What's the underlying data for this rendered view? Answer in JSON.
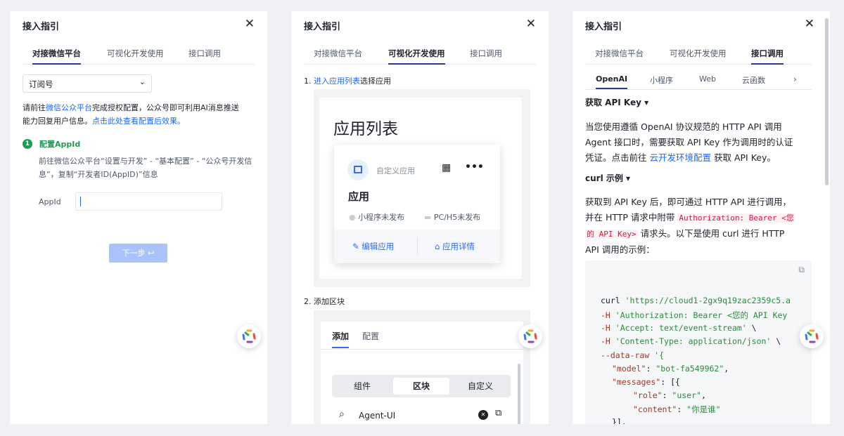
{
  "panel_title": "接入指引",
  "tabs": [
    "对接微信平台",
    "可视化开发使用",
    "接口调用"
  ],
  "p1": {
    "select_value": "订阅号",
    "desc_pre": "请前往",
    "desc_link": "微信公众平台",
    "desc_post": "完成授权配置，公众号即可利用AI消息推送",
    "desc_line2_pre": "能力回复用户信息。",
    "desc_line2_link": "点击此处查看配置后效果。",
    "step_num": "1",
    "step_title": "配置AppId",
    "step_desc_1": "前往微信公众平台“设置与开发” - “基本配置” - “公众号开发信",
    "step_desc_2": "息”，复制“开发者ID(AppID)”信息",
    "appid_label": "AppId",
    "next_label": "下一步 ↩"
  },
  "p2": {
    "step1_num": "1. ",
    "step1_link": "进入应用列表",
    "step1_post": "选择应用",
    "app_list_title": "应用列表",
    "custom_app": "自定义应用",
    "app_name": "应用",
    "status_mp": "小程序未发布",
    "status_pc": "PC/H5未发布",
    "edit_app": "编辑应用",
    "app_detail": "应用详情",
    "step2": "2. 添加区块",
    "add_tab": "添加",
    "config_tab": "配置",
    "seg": [
      "组件",
      "区块",
      "自定义"
    ],
    "search_value": "Agent-UI"
  },
  "p3": {
    "subtabs": [
      "OpenAI",
      "小程序",
      "Web",
      "云函数"
    ],
    "sec_api": "获取 API Key ▾",
    "api_l1": "当您使用遵循 OpenAI 协议规范的 HTTP API 调用",
    "api_l2": "Agent 接口时，需要获取 API Key 作为调用时的认证",
    "api_l3_pre": "凭证。点击前往 ",
    "api_l3_link": "云开发环境配置",
    "api_l3_post": " 获取 API Key。",
    "sec_curl": "curl 示例 ▾",
    "curl_l1": "获取到 API Key 后，即可通过 HTTP API 进行调用，",
    "curl_l2_pre": "并在 HTTP 请求中附带 ",
    "curl_l2_code": "Authorization: Bearer <您",
    "curl_l3_code": "的 API Key>",
    "curl_l3_post": " 请求头。以下是使用 curl 进行 HTTP",
    "curl_l4": "API 调用的示例：",
    "code": {
      "l1a": "curl ",
      "l1b": "'https://cloud1-2gx9q19zac2359c5.a",
      "l2a": "-H ",
      "l2b": "'Authorization: Bearer <您的 API Key",
      "l3a": "-H ",
      "l3b": "'Accept: text/event-stream'",
      "l3c": " \\",
      "l4a": "-H ",
      "l4b": "'Content-Type: application/json'",
      "l4c": " \\",
      "l5a": "--data-raw ",
      "l5b": "'{",
      "l6a": "\"model\"",
      "l6b": ": ",
      "l6c": "\"bot-fa549962\"",
      "l6d": ",",
      "l7a": "\"messages\"",
      "l7b": ": [{",
      "l8a": "\"role\"",
      "l8b": ": ",
      "l8c": "\"user\"",
      "l8d": ",",
      "l9a": "\"content\"",
      "l9b": ": ",
      "l9c": "\"你是谁\"",
      "l10": "}],"
    }
  }
}
